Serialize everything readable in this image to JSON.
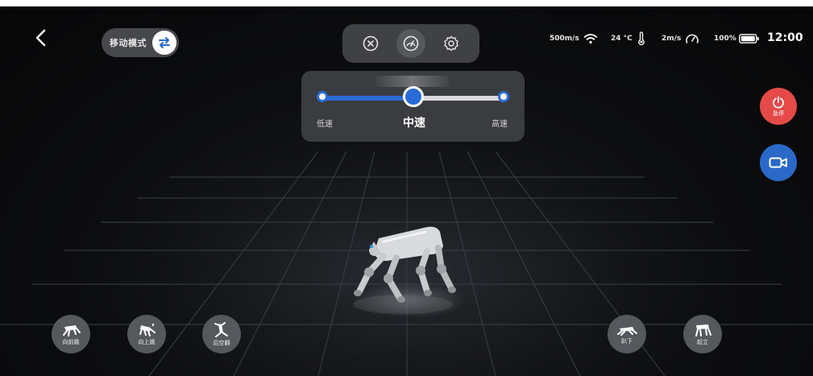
{
  "mode": {
    "label": "移动模式",
    "icon": "swap-arrows-icon"
  },
  "top_tabs": [
    {
      "name": "close-circle-icon",
      "active": false
    },
    {
      "name": "speedometer-icon",
      "active": true
    },
    {
      "name": "gear-icon",
      "active": false
    }
  ],
  "status": {
    "network": "500m/s",
    "temperature": "24 °C",
    "speed": "2m/s",
    "battery": "100%",
    "battery_level": 1.0,
    "time": "12:00"
  },
  "speed_panel": {
    "low_label": "低速",
    "current_label": "中速",
    "high_label": "高速",
    "level": 0.5,
    "accent_color": "#2b6bd6"
  },
  "estop": {
    "label": "急停",
    "color": "#e54a48"
  },
  "camera": {
    "color": "#2a69c8"
  },
  "actions_left": [
    {
      "label": "向前跳"
    },
    {
      "label": "向上跳"
    },
    {
      "label": "后空翻"
    }
  ],
  "actions_right": [
    {
      "label": "趴下"
    },
    {
      "label": "起立"
    }
  ]
}
